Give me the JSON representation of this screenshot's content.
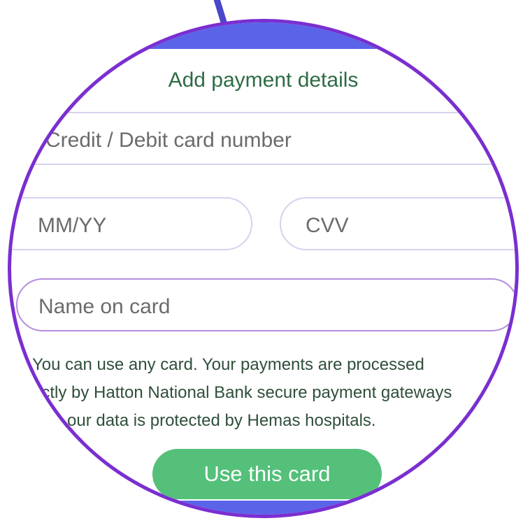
{
  "dialog": {
    "title": "Add payment details"
  },
  "form": {
    "card_number": {
      "placeholder": "Credit / Debit card number",
      "visible_text": "Credit / Debit card number"
    },
    "expiry": {
      "placeholder": "MM/YY",
      "visible_text": "MM/YY"
    },
    "cvv": {
      "placeholder": "CVV",
      "visible_text": "CVV"
    },
    "name_on_card": {
      "placeholder": "Name on card",
      "visible_text": "Name on card"
    }
  },
  "info_lines": [
    "You can use any card. Your payments are processed",
    "ectly by Hatton National Bank secure payment gateways",
    "our data is protected by Hemas hospitals."
  ],
  "buttons": {
    "use_card": "Use this card"
  },
  "colors": {
    "lens_border": "#7a2fd0",
    "header_bar": "#5b63e8",
    "title_text": "#2e6b44",
    "field_border": "#d8d0ee",
    "active_field_border": "#b48ddc",
    "primary_button": "#54c079",
    "pointer_line": "#4b47c8"
  }
}
